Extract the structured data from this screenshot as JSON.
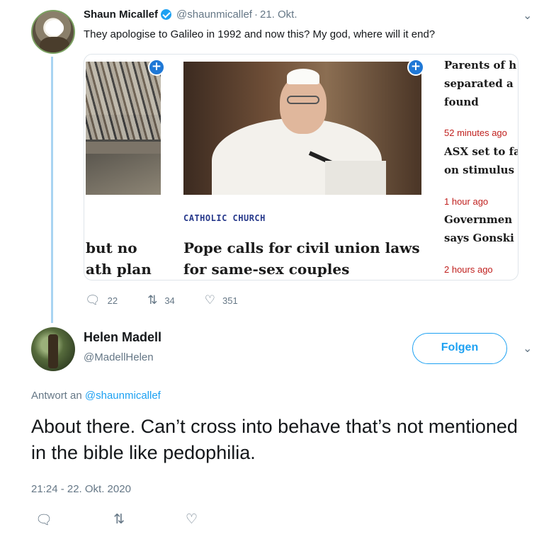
{
  "tweet1": {
    "display_name": "Shaun Micallef",
    "handle": "@shaunmicallef",
    "separator": "·",
    "date": "21. Okt.",
    "text": "They apologise to Galileo in 1992 and now this? My god, where will it end?",
    "card": {
      "left_headline_line1": "but no",
      "left_headline_line2": "ath plan",
      "category": "CATHOLIC CHURCH",
      "headline_line1": "Pope calls for civil union laws",
      "headline_line2": "for same-sex couples",
      "side_items": [
        {
          "line1": "Parents of h",
          "line2": "separated a",
          "line3": "found",
          "time": "52 minutes ago"
        },
        {
          "line1": "ASX set to fa",
          "line2": "on stimulus",
          "time": "1 hour ago"
        },
        {
          "line1": "Governmen",
          "line2": "says Gonski",
          "time": "2 hours ago"
        }
      ]
    },
    "actions": {
      "replies": "22",
      "retweets": "34",
      "likes": "351"
    }
  },
  "tweet2": {
    "display_name": "Helen Madell",
    "handle": "@MadellHelen",
    "follow_label": "Folgen",
    "replying_prefix": "Antwort an",
    "replying_to": "@shaunmicallef",
    "text": "About there. Can’t cross into behave that’s not mentioned in the bible like pedophilia.",
    "timestamp": "21:24 - 22. Okt. 2020"
  },
  "icons": {
    "reply": "reply-icon",
    "retweet": "retweet-icon",
    "like": "heart-icon",
    "more": "chevron-down-icon",
    "verified": "verified-badge-icon",
    "add": "plus-icon"
  },
  "colors": {
    "link": "#1da1f2",
    "muted": "#657786",
    "news_time": "#c0211f",
    "category": "#283a8c",
    "thread": "#a8d4f2"
  }
}
